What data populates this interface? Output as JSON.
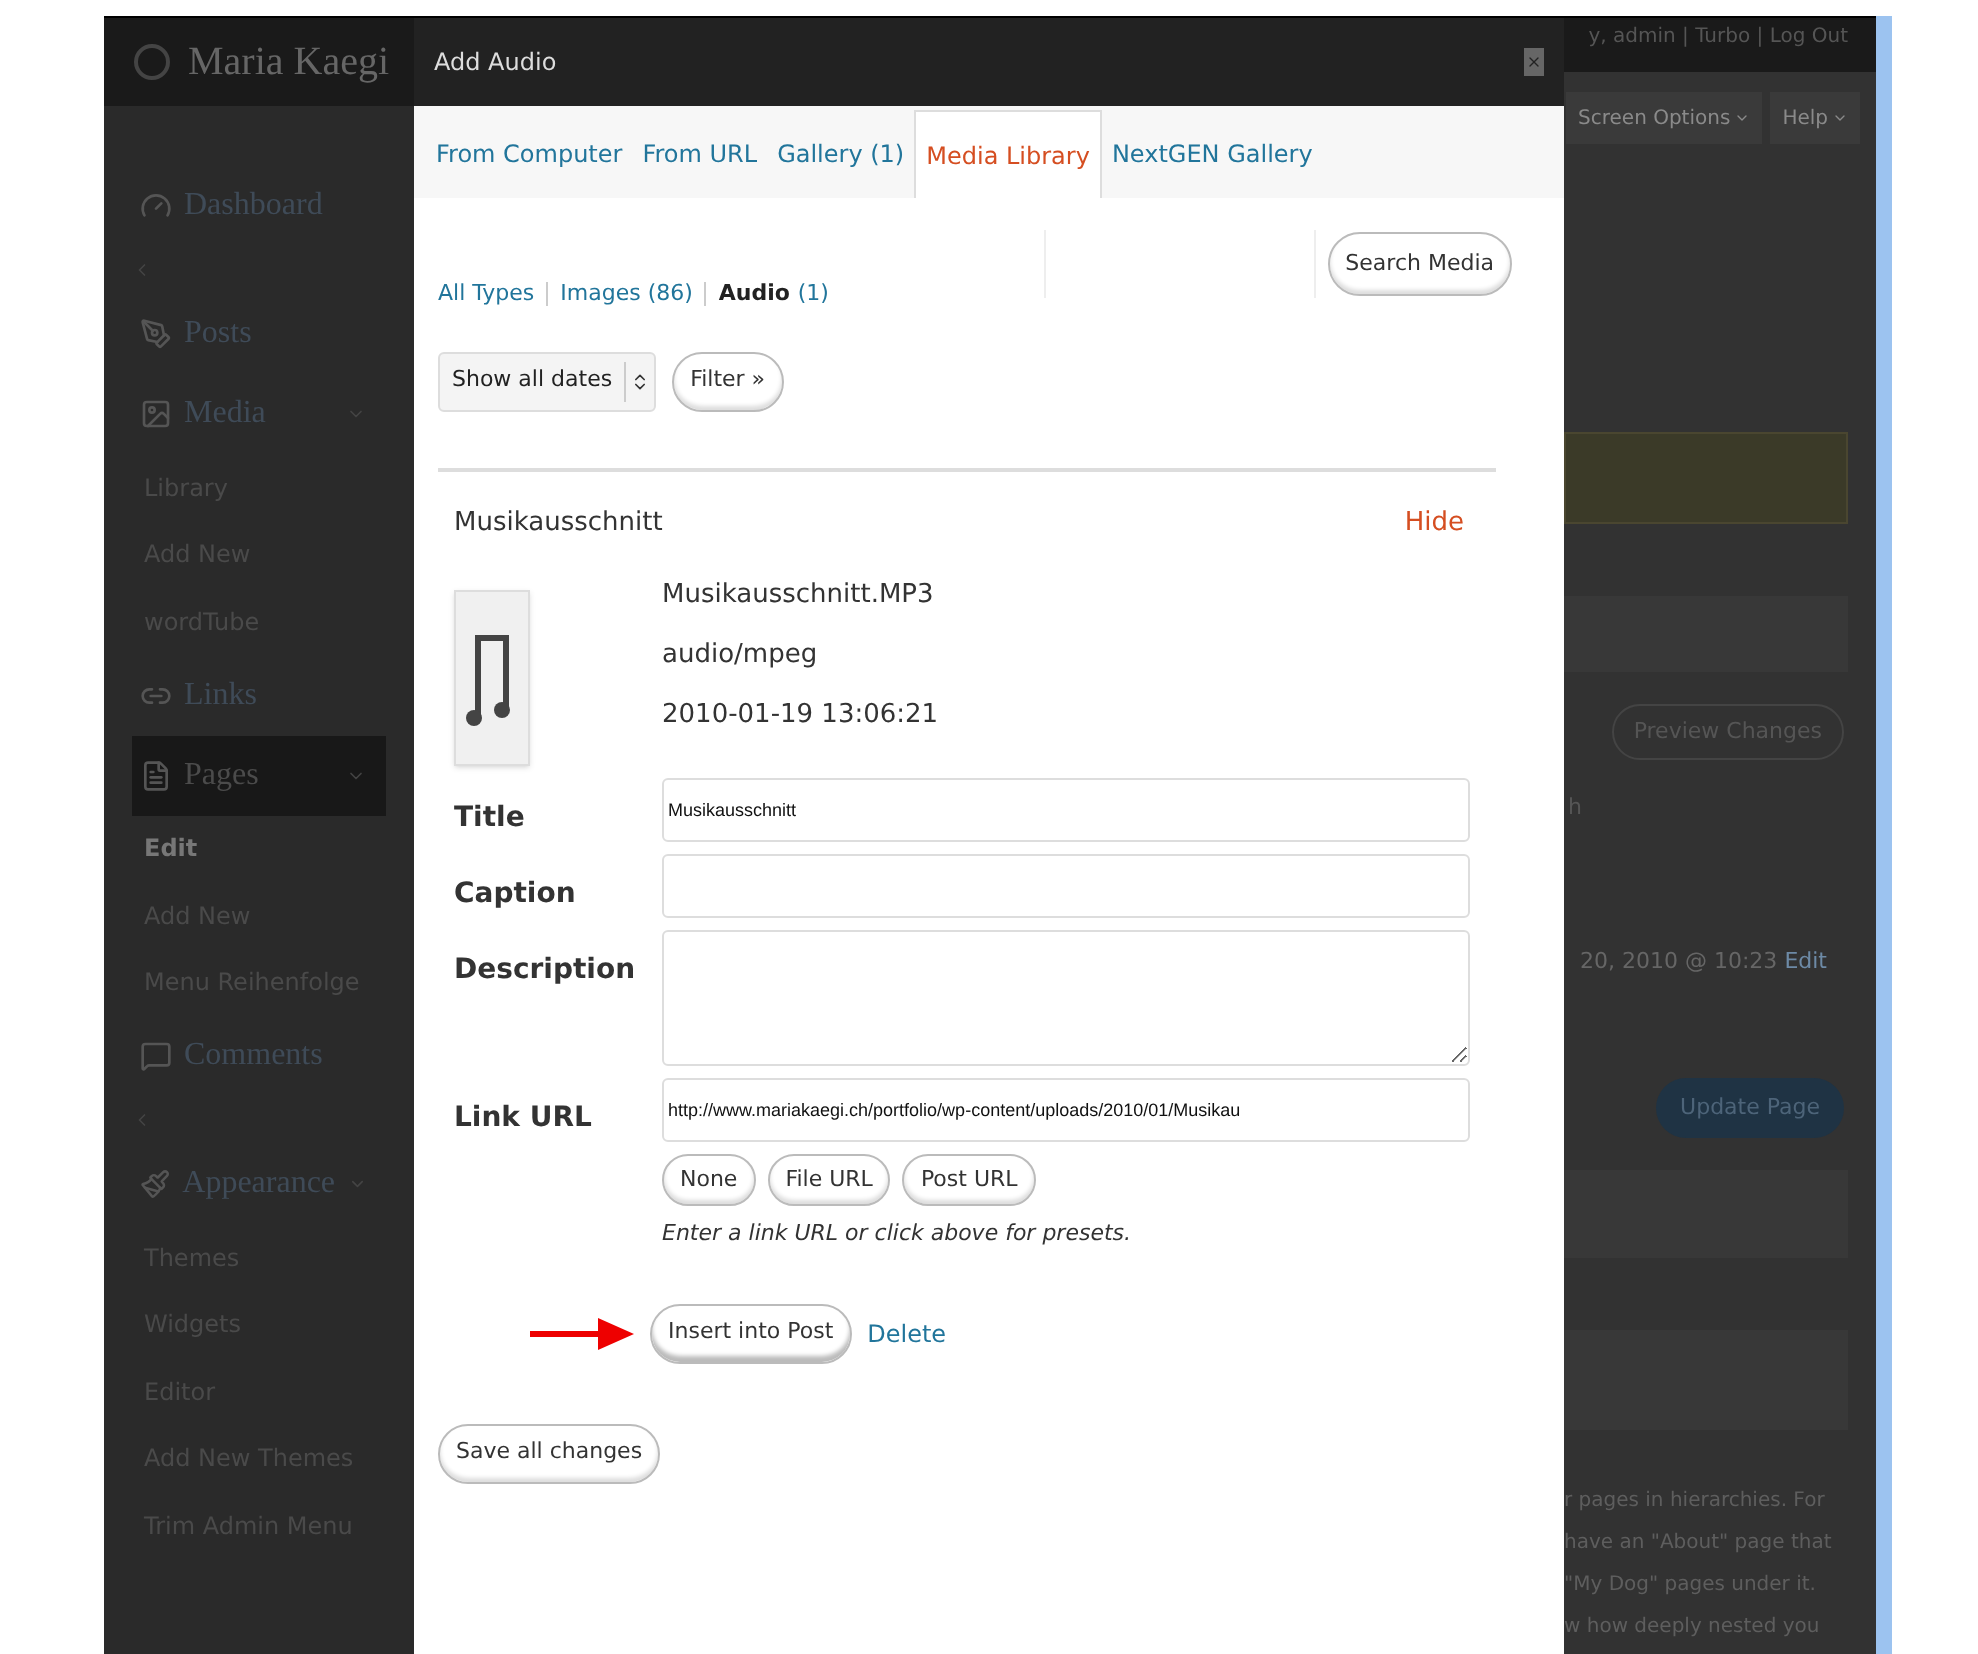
{
  "site": {
    "title": "Maria Kaegi",
    "user_links": "y, admin | Turbo | Log Out"
  },
  "sidebar": {
    "items": [
      {
        "kind": "menu",
        "label": "Dashboard",
        "selected": false,
        "expanded": false
      },
      {
        "kind": "separator"
      },
      {
        "kind": "menu",
        "label": "Posts",
        "selected": false,
        "expanded": false
      },
      {
        "kind": "menu",
        "label": "Media",
        "selected": false,
        "expanded": true,
        "children": [
          {
            "label": "Library",
            "current": false
          },
          {
            "label": "Add New",
            "current": false
          },
          {
            "label": "wordTube",
            "current": false
          }
        ]
      },
      {
        "kind": "menu",
        "label": "Links",
        "selected": false,
        "expanded": false
      },
      {
        "kind": "menu",
        "label": "Pages",
        "selected": true,
        "expanded": true,
        "children": [
          {
            "label": "Edit",
            "current": true
          },
          {
            "label": "Add New",
            "current": false
          },
          {
            "label": "Menu Reihenfolge",
            "current": false
          }
        ]
      },
      {
        "kind": "menu",
        "label": "Comments",
        "selected": false,
        "expanded": false
      },
      {
        "kind": "separator"
      },
      {
        "kind": "menu",
        "label": "Appearance",
        "selected": false,
        "expanded": true,
        "children": [
          {
            "label": "Themes",
            "current": false
          },
          {
            "label": "Widgets",
            "current": false
          },
          {
            "label": "Editor",
            "current": false
          },
          {
            "label": "Add New Themes",
            "current": false
          },
          {
            "label": "Trim Admin Menu",
            "current": false
          }
        ]
      }
    ]
  },
  "background_page": {
    "screen_options": "Screen Options",
    "help": "Help",
    "preview_button": "Preview Changes",
    "cut_text": "h",
    "date_line": "20, 2010 @ 10:23",
    "edit_link": "Edit",
    "update_button": "Update Page",
    "help_lines": [
      "r pages in hierarchies. For",
      "have an \"About\" page that",
      "\"My Dog\" pages under it.",
      "w how deeply nested you"
    ]
  },
  "dialog": {
    "title": "Add Audio",
    "tabs": [
      {
        "label": "From Computer",
        "selected": false
      },
      {
        "label": "From URL",
        "selected": false
      },
      {
        "label": "Gallery (1)",
        "selected": false
      },
      {
        "label": "Media Library",
        "selected": true
      },
      {
        "label": "NextGEN Gallery",
        "selected": false
      }
    ],
    "type_filters": [
      {
        "label": "All Types",
        "selected": false
      },
      {
        "label": "Images",
        "count": "(86)",
        "selected": false
      },
      {
        "label": "Audio",
        "count": "(1)",
        "selected": true
      }
    ],
    "search_button": "Search Media",
    "date_select": "Show all dates",
    "filter_button": "Filter »",
    "item": {
      "name": "Musikausschnitt",
      "hide_link": "Hide",
      "file_info": [
        "Musikausschnitt.MP3",
        "audio/mpeg",
        "2010-01-19 13:06:21"
      ],
      "fields": [
        {
          "kind": "input",
          "label": "Title",
          "value": "Musikausschnitt"
        },
        {
          "kind": "input",
          "label": "Caption"
        },
        {
          "kind": "textarea",
          "label": "Description"
        },
        {
          "kind": "input",
          "label": "Link URL",
          "value": "http://www.mariakaegi.ch/portfolio/wp-content/uploads/2010/01/Musikau"
        }
      ],
      "link_buttons": [
        "None",
        "File URL",
        "Post URL"
      ],
      "link_help": "Enter a link URL or click above for presets.",
      "insert_button": "Insert into Post",
      "delete_link": "Delete"
    },
    "save_button": "Save all changes"
  }
}
